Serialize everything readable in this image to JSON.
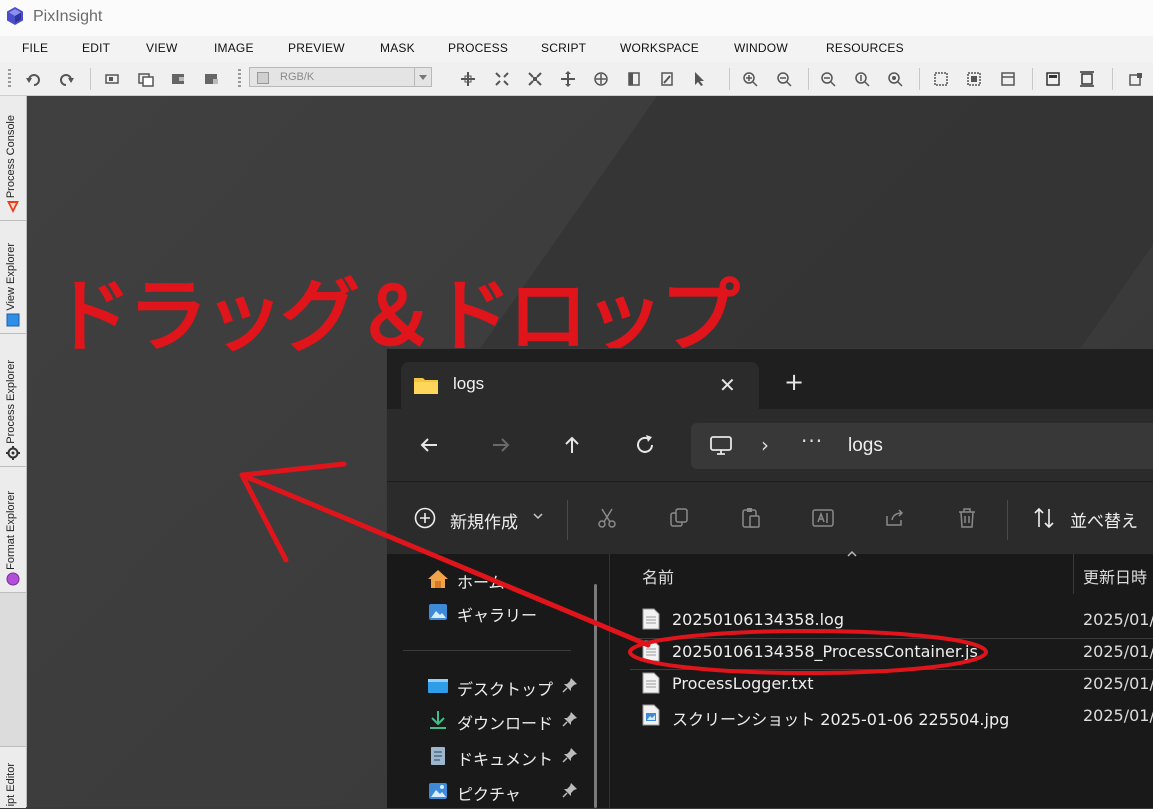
{
  "app": {
    "title": "PixInsight",
    "logo_icon": "pixinsight-logo-icon"
  },
  "menu": [
    "FILE",
    "EDIT",
    "VIEW",
    "IMAGE",
    "PREVIEW",
    "MASK",
    "PROCESS",
    "SCRIPT",
    "WORKSPACE",
    "WINDOW",
    "RESOURCES"
  ],
  "toolbar": {
    "color_space": "RGB/K"
  },
  "sidebar": {
    "tabs": [
      {
        "label": "Process Console",
        "icon": "process-console-icon"
      },
      {
        "label": "View Explorer",
        "icon": "view-explorer-icon"
      },
      {
        "label": "Process Explorer",
        "icon": "gear-icon"
      },
      {
        "label": "Format Explorer",
        "icon": "format-explorer-icon"
      },
      {
        "label": "Script Editor",
        "icon": "script-editor-icon"
      }
    ],
    "bottom_tab_visible_text": "ipt Editor"
  },
  "annotation": {
    "text": "ドラッグ＆ドロップ",
    "color": "#e0141b"
  },
  "explorer": {
    "tab_title": "logs",
    "address": {
      "separator": "›",
      "overflow": "···",
      "current": "logs"
    },
    "commands": {
      "new_label": "新規作成",
      "sort_label": "並べ替え"
    },
    "nav": [
      {
        "label": "ホーム",
        "icon": "home-icon",
        "pinned": false
      },
      {
        "label": "ギャラリー",
        "icon": "gallery-icon",
        "pinned": false
      },
      {
        "label": "デスクトップ",
        "icon": "desktop-icon",
        "pinned": true
      },
      {
        "label": "ダウンロード",
        "icon": "download-icon",
        "pinned": true
      },
      {
        "label": "ドキュメント",
        "icon": "documents-icon",
        "pinned": true
      },
      {
        "label": "ピクチャ",
        "icon": "pictures-icon",
        "pinned": true
      }
    ],
    "columns": {
      "name": "名前",
      "modified": "更新日時"
    },
    "files": [
      {
        "name": "20250106134358.log",
        "date": "2025/01/",
        "icon": "text-file-icon"
      },
      {
        "name": "20250106134358_ProcessContainer.js",
        "date": "2025/01/",
        "icon": "script-file-icon",
        "selected": true
      },
      {
        "name": "ProcessLogger.txt",
        "date": "2025/01/",
        "icon": "text-file-icon"
      },
      {
        "name": "スクリーンショット 2025-01-06 225504.jpg",
        "date": "2025/01/",
        "icon": "image-file-icon"
      }
    ]
  }
}
